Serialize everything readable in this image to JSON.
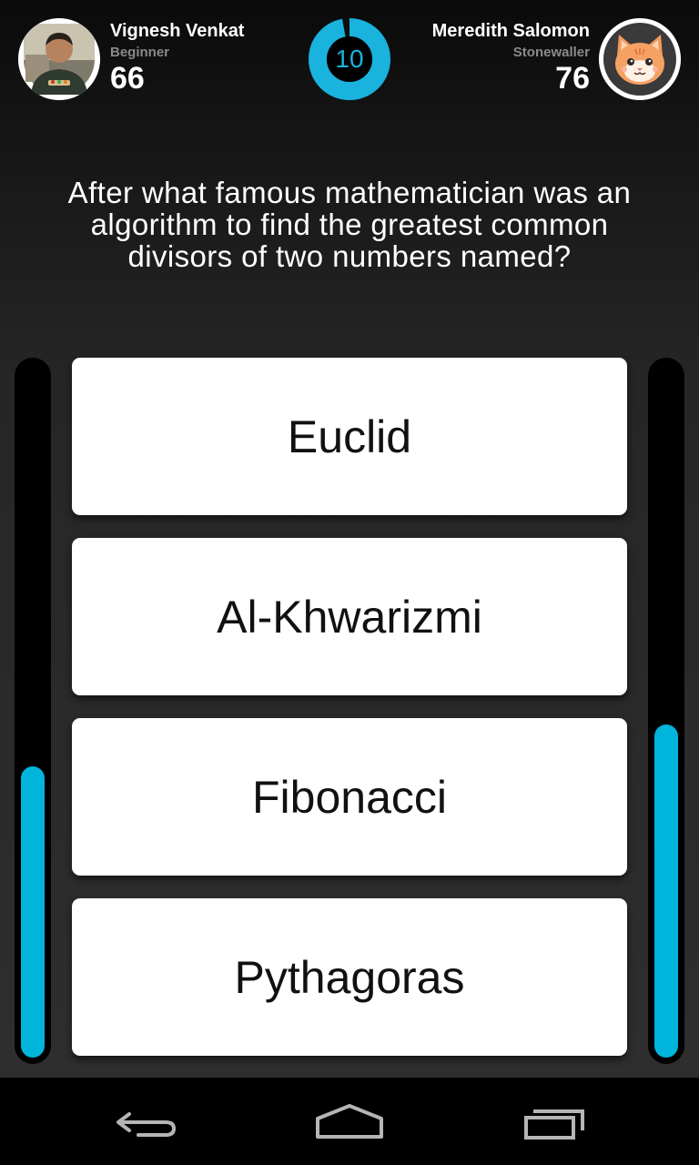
{
  "players": {
    "left": {
      "name": "Vignesh Venkat",
      "level": "Beginner",
      "score": "66",
      "avatar_icon": "person-photo-avatar"
    },
    "right": {
      "name": "Meredith Salomon",
      "level": "Stonewaller",
      "score": "76",
      "avatar_icon": "cat-face-avatar"
    }
  },
  "timer": {
    "value": "10",
    "remaining_fraction": 0.97,
    "color": "#19b3dd"
  },
  "question": "After what famous mathematician was an algorithm to find the greatest common divisors of two numbers named?",
  "answers": [
    {
      "label": "Euclid"
    },
    {
      "label": "Al-Khwarizmi"
    },
    {
      "label": "Fibonacci"
    },
    {
      "label": "Pythagoras"
    }
  ],
  "progress": {
    "left_fraction": 0.42,
    "right_fraction": 0.48,
    "color": "#00b4dc"
  },
  "nav": {
    "back_icon": "back-arrow-icon",
    "home_icon": "home-icon",
    "recents_icon": "recent-apps-icon"
  }
}
